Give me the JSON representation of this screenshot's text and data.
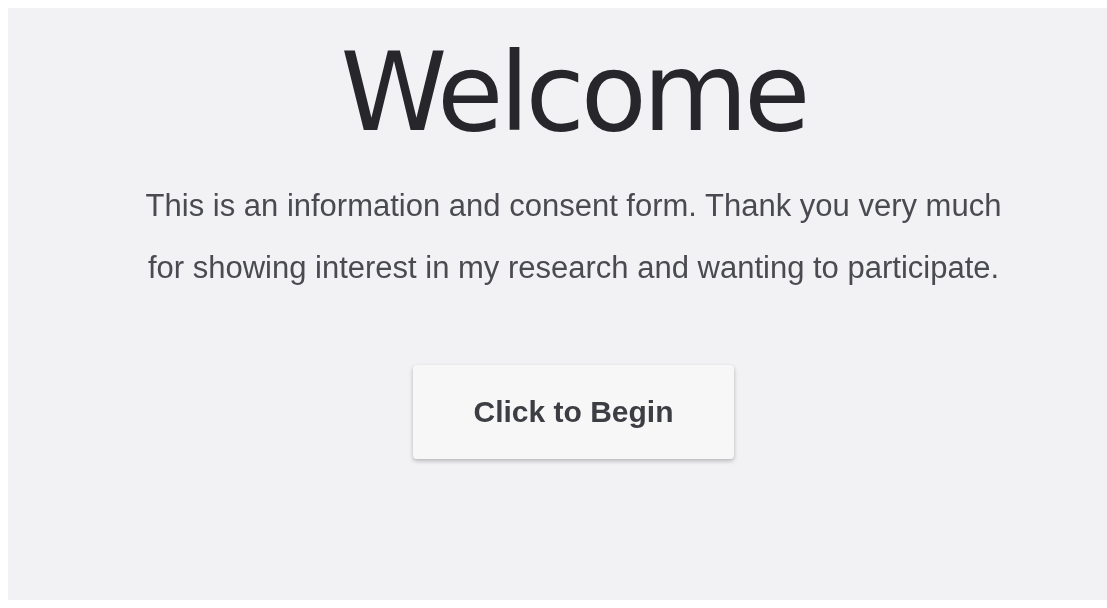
{
  "title": "Welcome",
  "intro": "This is an information and consent form. Thank you very much for showing interest in my research and wanting to participate.",
  "button": "Click to Begin"
}
